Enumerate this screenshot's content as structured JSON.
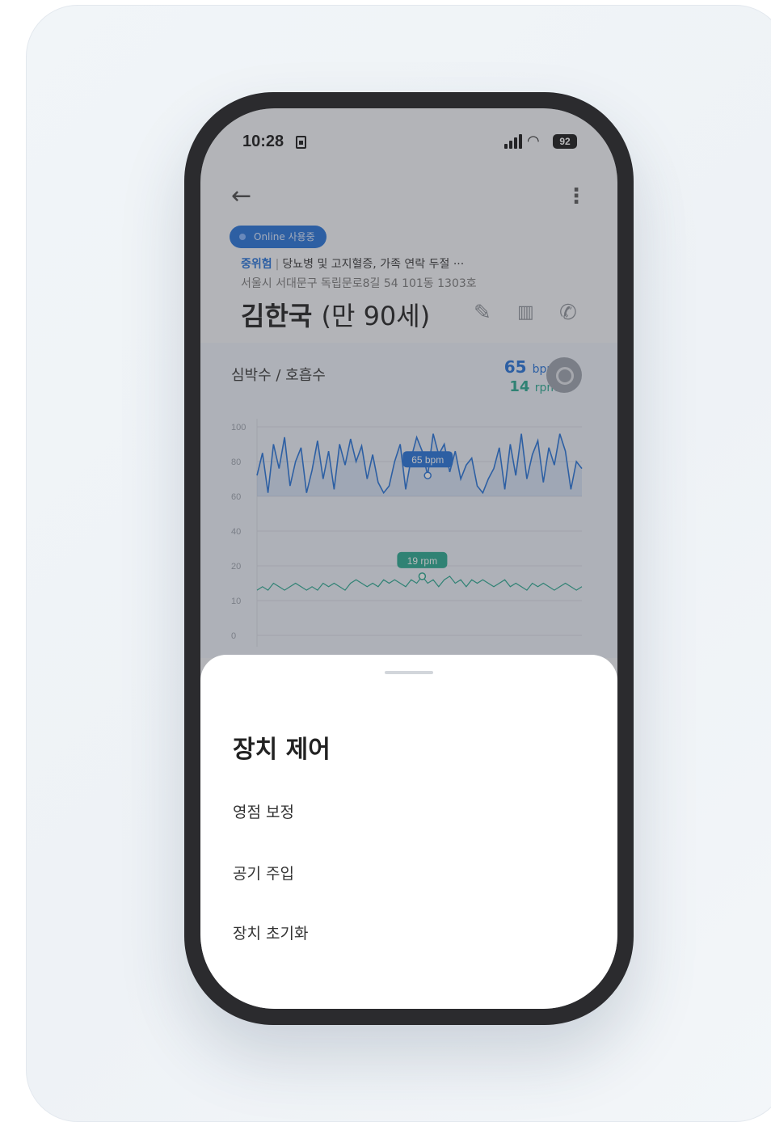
{
  "status_bar": {
    "time": "10:28",
    "battery": "92"
  },
  "patient": {
    "online_badge": "Online 사용중",
    "risk_level": "중위험",
    "conditions": "당뇨병 및 고지혈증, 가족 연락 두절 ···",
    "address": "서울시 서대문구 독립문로8길 54 101동 1303호",
    "name": "김한국",
    "age": "(만 90세)"
  },
  "icons": [
    "back-arrow-icon",
    "more-vertical-icon",
    "edit-icon",
    "map-icon",
    "phone-icon",
    "clock-settings-icon"
  ],
  "vitals": {
    "title": "심박수 / 호흡수",
    "bpm_value": "65",
    "bpm_unit": "bpm",
    "rpm_value": "14",
    "rpm_unit": "rpm"
  },
  "chart_data": {
    "type": "line",
    "y_ticks": [
      "100",
      "80",
      "60",
      "40",
      "20",
      "10",
      "0"
    ],
    "series": [
      {
        "values": [
          72,
          85,
          62,
          90,
          76,
          94,
          66,
          80,
          88,
          62,
          75,
          92,
          70,
          86,
          64,
          90,
          78,
          93,
          80,
          89,
          70,
          84,
          68,
          62,
          66,
          80,
          90,
          64,
          82,
          94,
          86,
          72,
          96,
          84,
          90,
          74,
          86,
          70,
          78,
          82,
          66,
          62,
          70,
          76,
          88,
          64,
          90,
          72,
          96,
          70,
          84,
          92,
          68,
          88,
          78,
          96,
          86,
          64,
          80,
          76
        ],
        "color": "#1e6fd9",
        "marker_label": "65 bpm",
        "marker_index": 31
      },
      {
        "values": [
          13,
          14,
          13,
          15,
          14,
          13,
          14,
          15,
          14,
          13,
          14,
          13,
          15,
          14,
          15,
          14,
          13,
          15,
          16,
          15,
          14,
          15,
          14,
          16,
          15,
          16,
          15,
          14,
          16,
          15,
          17,
          15,
          16,
          14,
          16,
          17,
          15,
          16,
          14,
          16,
          15,
          16,
          15,
          14,
          15,
          16,
          14,
          15,
          14,
          13,
          15,
          14,
          15,
          14,
          13,
          14,
          15,
          14,
          13,
          14
        ],
        "color": "#23a68d",
        "marker_label": "19 rpm",
        "marker_index": 30
      }
    ],
    "ylim": [
      0,
      100
    ],
    "grid": true
  },
  "sheet": {
    "title": "장치 제어",
    "items": [
      "영점 보정",
      "공기 주입",
      "장치 초기화"
    ]
  },
  "colors": {
    "primary": "#1e6fd9",
    "teal": "#23a68d",
    "badge": "#1e6fd9"
  }
}
